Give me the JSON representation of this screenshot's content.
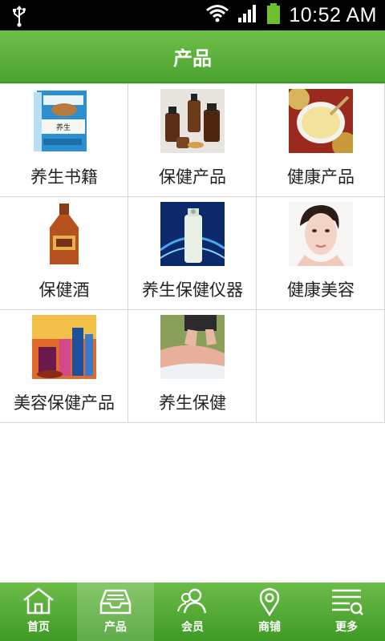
{
  "status_bar": {
    "time": "10:52 AM"
  },
  "header": {
    "title": "产品"
  },
  "products": [
    {
      "label": "养生书籍",
      "icon": "book-image"
    },
    {
      "label": "保健产品",
      "icon": "bottles-image"
    },
    {
      "label": "健康产品",
      "icon": "drink-image"
    },
    {
      "label": "保健酒",
      "icon": "wine-bottle-image"
    },
    {
      "label": "养生保健仪器",
      "icon": "device-image"
    },
    {
      "label": "健康美容",
      "icon": "face-image"
    },
    {
      "label": "美容保健产品",
      "icon": "cosmetics-image"
    },
    {
      "label": "养生保健",
      "icon": "massage-image"
    }
  ],
  "tabs": [
    {
      "label": "首页",
      "icon": "home-icon",
      "active": false
    },
    {
      "label": "产品",
      "icon": "inbox-icon",
      "active": true
    },
    {
      "label": "会员",
      "icon": "members-icon",
      "active": false
    },
    {
      "label": "商铺",
      "icon": "location-pin-icon",
      "active": false
    },
    {
      "label": "更多",
      "icon": "menu-icon",
      "active": false
    }
  ],
  "colors": {
    "header_green": "#5bb13a",
    "tabbar_green": "#4aa32e"
  }
}
